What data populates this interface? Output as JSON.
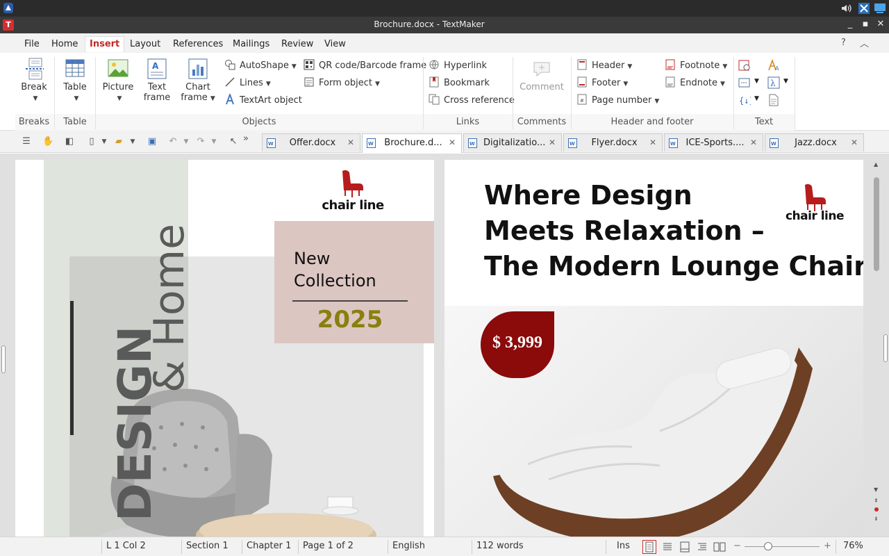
{
  "window": {
    "title": "Brochure.docx - TextMaker",
    "app_icon_letter": "T"
  },
  "menu": {
    "tabs": [
      "File",
      "Home",
      "Insert",
      "Layout",
      "References",
      "Mailings",
      "Review",
      "View"
    ],
    "active": "Insert"
  },
  "ribbon": {
    "groups": {
      "breaks": "Breaks",
      "table": "Table",
      "objects": "Objects",
      "links": "Links",
      "comments": "Comments",
      "header_footer": "Header and footer",
      "text": "Text"
    },
    "buttons": {
      "break": "Break",
      "table": "Table",
      "picture": "Picture",
      "text_frame_1": "Text",
      "text_frame_2": "frame",
      "chart_frame_1": "Chart",
      "chart_frame_2": "frame",
      "autoshape": "AutoShape",
      "lines": "Lines",
      "textart": "TextArt object",
      "qr_code": "QR code/Barcode frame",
      "form_object": "Form object",
      "hyperlink": "Hyperlink",
      "bookmark": "Bookmark",
      "cross_reference": "Cross reference",
      "comment": "Comment",
      "header": "Header",
      "footer": "Footer",
      "page_number": "Page number",
      "footnote": "Footnote",
      "endnote": "Endnote"
    }
  },
  "doc_tabs": [
    {
      "label": "Offer.docx",
      "active": false
    },
    {
      "label": "Brochure.d...",
      "active": true
    },
    {
      "label": "Digitalizatio...",
      "active": false
    },
    {
      "label": "Flyer.docx",
      "active": false
    },
    {
      "label": "ICE-Sports....",
      "active": false
    },
    {
      "label": "Jazz.docx",
      "active": false
    }
  ],
  "page1": {
    "logo_text": "chair line",
    "vertical_title_1": "DESIGN",
    "vertical_title_2": "& Home",
    "box_line1": "New",
    "box_line2": "Collection",
    "box_year": "2025"
  },
  "page2": {
    "heading_line1": "Where Design",
    "heading_line2": "Meets Relaxation –",
    "heading_line3": "The Modern Lounge Chair",
    "logo_text": "chair line",
    "price": "$ 3,999"
  },
  "status": {
    "position": "L 1 Col 2",
    "section": "Section 1",
    "chapter": "Chapter 1",
    "page": "Page 1 of 2",
    "language": "English",
    "words": "112 words",
    "mode": "Ins",
    "zoom": "76%"
  },
  "colors": {
    "accent": "#c62828",
    "brand_red": "#b71c1c",
    "price_badge": "#8b0a0a",
    "olive": "#8a7f0e",
    "pink_box": "#dcc6c1",
    "sage": "#dfe4dc"
  }
}
